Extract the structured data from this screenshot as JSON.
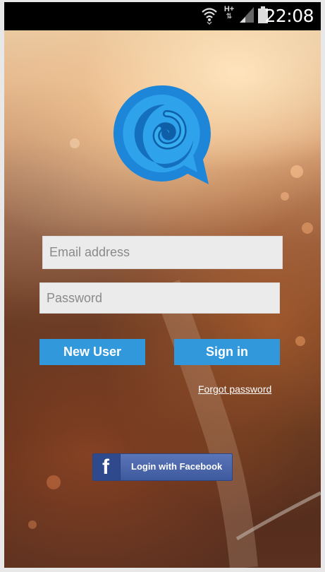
{
  "status_bar": {
    "time": "22:08",
    "network_label": "H+",
    "icons": [
      "wifi-icon",
      "h-plus-network-icon",
      "signal-icon",
      "battery-icon"
    ]
  },
  "app": {
    "logo_icon": "speech-bubble-swirl-logo",
    "accent_color": "#3198dc"
  },
  "form": {
    "email_placeholder": "Email address",
    "password_placeholder": "Password",
    "new_user_label": "New User",
    "sign_in_label": "Sign in",
    "forgot_password_label": "Forgot password",
    "facebook_label": "Login with Facebook",
    "facebook_color": "#3b5998"
  }
}
